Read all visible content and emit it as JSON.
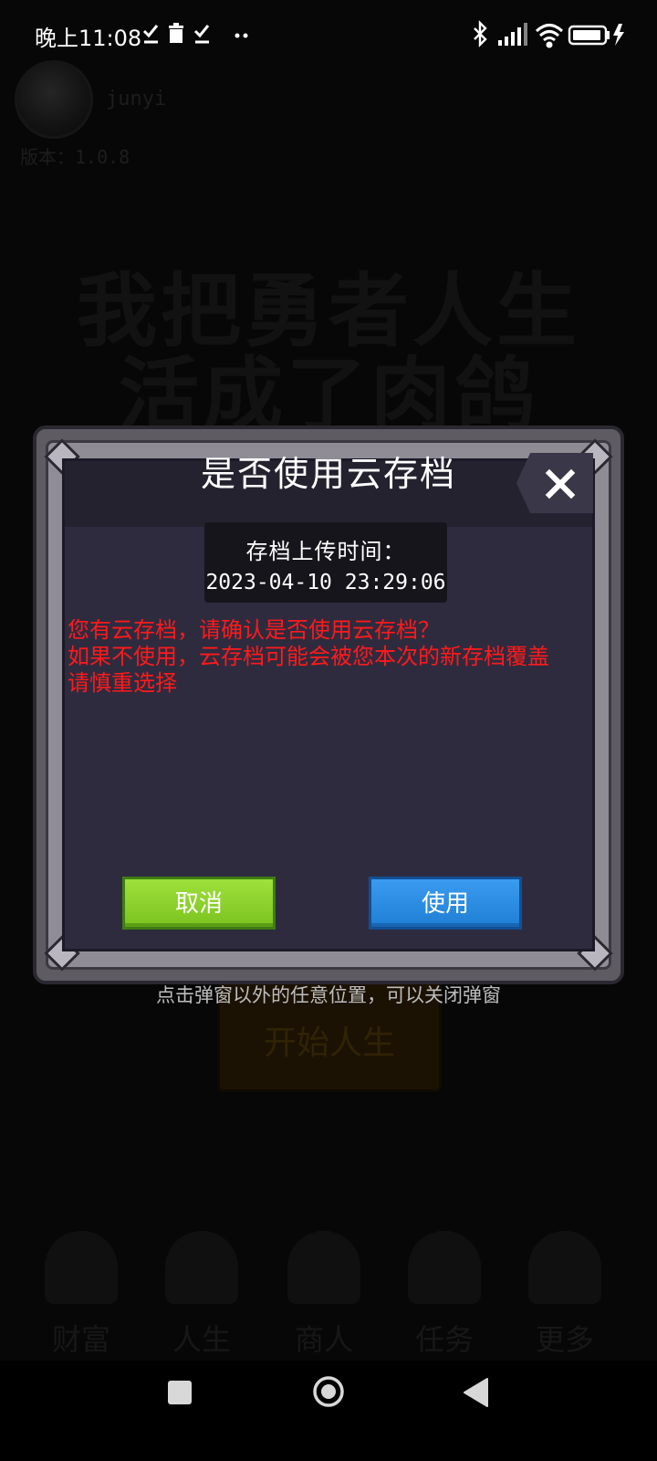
{
  "status_bar": {
    "time": "晚上11:08",
    "left_icons": [
      "download-done-icon",
      "trash-icon",
      "download-done-icon",
      "more-dots-icon"
    ],
    "right_icons": [
      "bluetooth-icon",
      "signal-icon",
      "wifi-icon",
      "battery-charging-icon"
    ]
  },
  "background": {
    "username": "junyi",
    "version": "版本：1.0.8",
    "title_line1": "我把勇者人生",
    "title_line2": "活成了肉鸽",
    "start_button": "开始人生",
    "nav": [
      {
        "label": "财富",
        "icon": "lock-icon"
      },
      {
        "label": "人生",
        "icon": "lock-icon"
      },
      {
        "label": "商人",
        "icon": "lock-icon"
      },
      {
        "label": "任务",
        "icon": "lock-icon"
      },
      {
        "label": "更多",
        "icon": "more-icon"
      }
    ]
  },
  "dialog": {
    "title": "是否使用云存档",
    "upload_time_label": "存档上传时间：",
    "upload_time_value": "2023-04-10 23:29:06",
    "message_lines": [
      "您有云存档，请确认是否使用云存档？",
      "如果不使用，云存档可能会被您本次的新存档覆盖",
      "请慎重选择"
    ],
    "cancel_label": "取消",
    "use_label": "使用",
    "colors": {
      "message": "#ff1a1a",
      "cancel_button": "#8fd22e",
      "use_button": "#2a8ae0",
      "panel": "#2e2b3f"
    }
  },
  "hint": "点击弹窗以外的任意位置，可以关闭弹窗",
  "nav_bar": {
    "icons": [
      "recents-square-icon",
      "home-circle-icon",
      "back-triangle-icon"
    ]
  }
}
